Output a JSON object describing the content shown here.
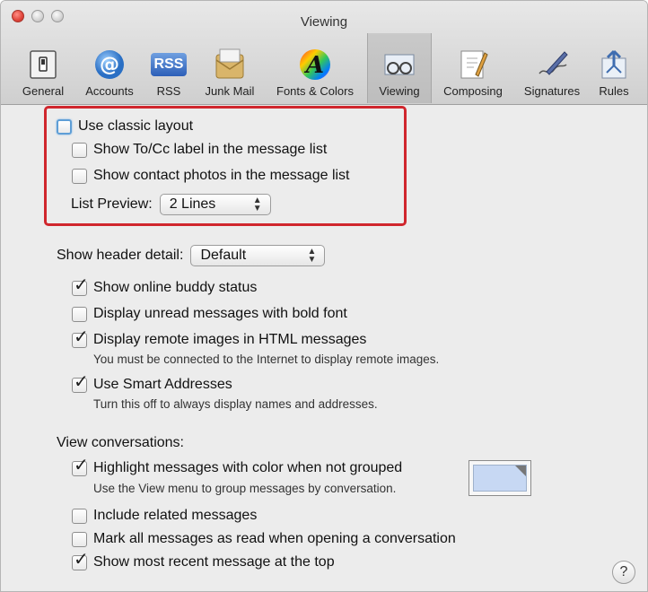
{
  "window": {
    "title": "Viewing"
  },
  "toolbar": {
    "items": [
      {
        "label": "General",
        "icon": "general-switch-icon"
      },
      {
        "label": "Accounts",
        "icon": "at-sign-icon"
      },
      {
        "label": "RSS",
        "icon": "rss-icon",
        "badge": "RSS"
      },
      {
        "label": "Junk Mail",
        "icon": "junk-mail-icon"
      },
      {
        "label": "Fonts & Colors",
        "icon": "fonts-colors-icon",
        "glyph": "A"
      },
      {
        "label": "Viewing",
        "icon": "viewing-glasses-icon",
        "selected": true
      },
      {
        "label": "Composing",
        "icon": "composing-icon"
      },
      {
        "label": "Signatures",
        "icon": "signature-pen-icon"
      },
      {
        "label": "Rules",
        "icon": "rules-icon"
      }
    ]
  },
  "classic": {
    "use_classic_layout": "Use classic layout",
    "show_tocc": "Show To/Cc label in the message list",
    "show_contact_photos": "Show contact photos in the message list",
    "list_preview_label": "List Preview:",
    "list_preview_value": "2 Lines"
  },
  "header": {
    "label": "Show header detail:",
    "value": "Default"
  },
  "options": {
    "buddy_status": "Show online buddy status",
    "unread_bold": "Display unread messages with bold font",
    "remote_images": "Display remote images in HTML messages",
    "remote_images_note": "You must be connected to the Internet to display remote images.",
    "smart_addresses": "Use Smart Addresses",
    "smart_addresses_note": "Turn this off to always display names and addresses."
  },
  "conversations": {
    "label": "View conversations:",
    "highlight": "Highlight messages with color when not grouped",
    "highlight_note": "Use the View menu to group messages by conversation.",
    "highlight_color": "#c7d8f3",
    "related": "Include related messages",
    "mark_read": "Mark all messages as read when opening a conversation",
    "recent_top": "Show most recent message at the top"
  },
  "help": {
    "label": "?"
  },
  "colors": {
    "accent_red": "#d0262d",
    "focus_blue": "#5e9ed6"
  }
}
